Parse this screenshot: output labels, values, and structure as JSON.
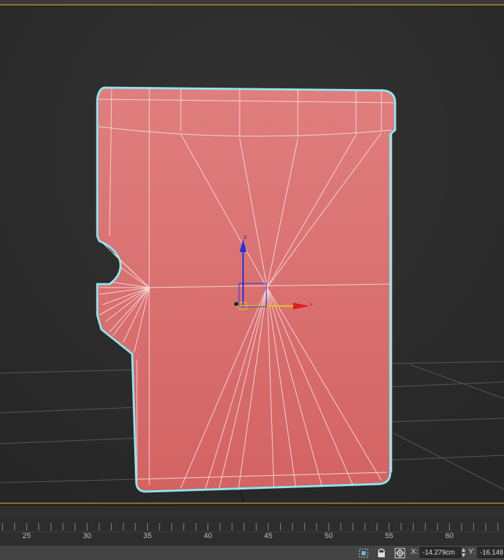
{
  "viewport": {
    "background": "#2b2b2b",
    "mesh_color": "#d76c6c",
    "selection_outline_color": "#7fe6f0",
    "gizmo": {
      "x_axis_label": "x",
      "z_axis_label": "z",
      "x_color": "#e11d1d",
      "z_color": "#1a33e6",
      "y_color": "#e6c21a"
    }
  },
  "timeline": {
    "tick_labels": [
      "25",
      "30",
      "35",
      "40",
      "45",
      "50",
      "55",
      "60"
    ]
  },
  "statusbar": {
    "selection_lock_icon": "selection-filter-icon",
    "lock_icon": "lock-icon",
    "transform_mode_icon": "absolute-transform-icon",
    "x_label": "X:",
    "x_value": "-14.279cm",
    "y_label": "Y:",
    "y_value": "-16.148"
  }
}
